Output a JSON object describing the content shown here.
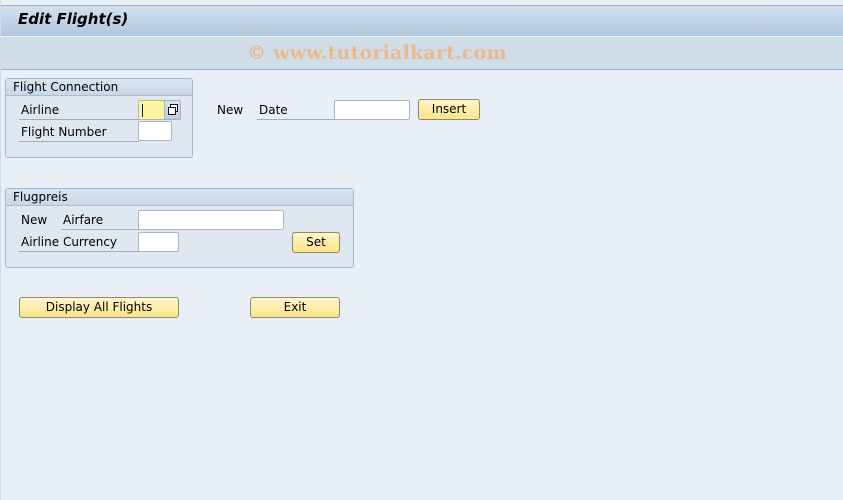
{
  "window": {
    "title": "Edit Flight(s)",
    "watermark": "© www.tutorialkart.com"
  },
  "flight_connection": {
    "title": "Flight Connection",
    "airline_label": "Airline",
    "airline_value": "",
    "flight_number_label": "Flight Number",
    "flight_number_value": ""
  },
  "date_row": {
    "new_label": "New",
    "date_label": "Date",
    "date_value": "",
    "insert_button": "Insert"
  },
  "flugpreis": {
    "title": "Flugpreis",
    "new_label": "New",
    "airfare_label": "Airfare",
    "airfare_value": "",
    "currency_label": "Airline Currency",
    "currency_value": "",
    "set_button": "Set"
  },
  "actions": {
    "display_all_flights": "Display All Flights",
    "exit": "Exit"
  },
  "icons": {
    "value_help": "value-help-icon"
  },
  "colors": {
    "background": "#e8eff7",
    "button_fill": "#fbe48c",
    "focused_input": "#fff3a3",
    "watermark": "#e9b98b"
  }
}
